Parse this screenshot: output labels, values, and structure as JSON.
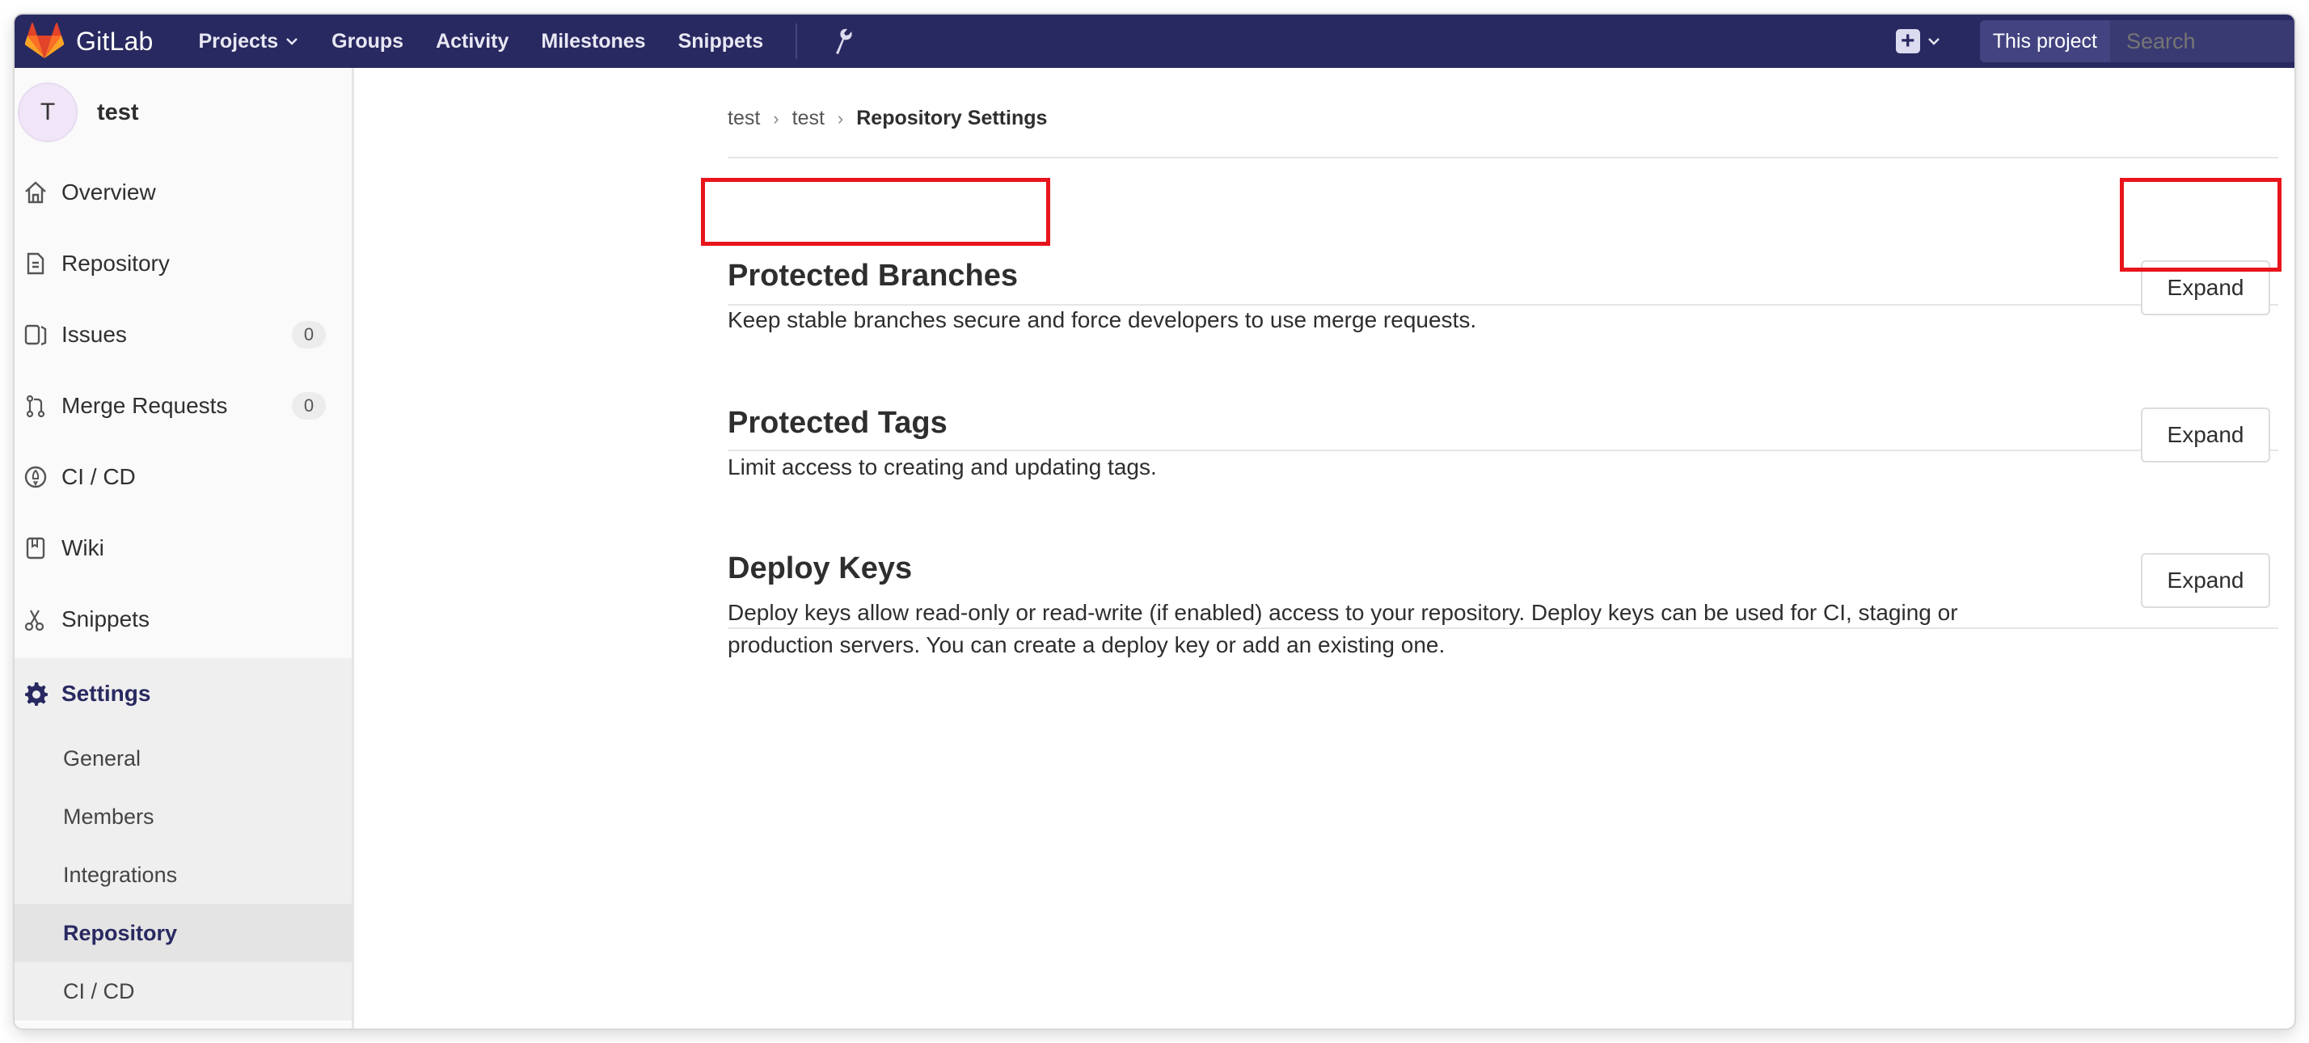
{
  "navbar": {
    "brand": "GitLab",
    "items": [
      {
        "label": "Projects",
        "has_dropdown": true
      },
      {
        "label": "Groups"
      },
      {
        "label": "Activity"
      },
      {
        "label": "Milestones"
      },
      {
        "label": "Snippets"
      }
    ],
    "scope_label": "This project",
    "search_placeholder": "Search",
    "colors": {
      "background": "#292961",
      "logo_orange": "#fc6d26"
    }
  },
  "sidebar": {
    "project_initial": "T",
    "project_name": "test",
    "items": [
      {
        "label": "Overview",
        "icon": "home-icon"
      },
      {
        "label": "Repository",
        "icon": "document-icon"
      },
      {
        "label": "Issues",
        "icon": "issues-icon",
        "count": "0"
      },
      {
        "label": "Merge Requests",
        "icon": "merge-request-icon",
        "count": "0"
      },
      {
        "label": "CI / CD",
        "icon": "rocket-icon"
      },
      {
        "label": "Wiki",
        "icon": "book-icon"
      },
      {
        "label": "Snippets",
        "icon": "scissors-icon"
      },
      {
        "label": "Settings",
        "icon": "gear-icon",
        "active": true
      }
    ],
    "settings_sub": [
      {
        "label": "General"
      },
      {
        "label": "Members"
      },
      {
        "label": "Integrations"
      },
      {
        "label": "Repository",
        "active": true
      },
      {
        "label": "CI / CD"
      }
    ]
  },
  "breadcrumb": {
    "items": [
      "test",
      "test"
    ],
    "current": "Repository Settings"
  },
  "sections": [
    {
      "title": "Protected Branches",
      "description": "Keep stable branches secure and force developers to use merge requests.",
      "button": "Expand"
    },
    {
      "title": "Protected Tags",
      "description": "Limit access to creating and updating tags.",
      "button": "Expand"
    },
    {
      "title": "Deploy Keys",
      "description_line1": "Deploy keys allow read-only or read-write (if enabled) access to your repository. Deploy keys can be used for CI, staging or",
      "description_line2": "production servers. You can create a deploy key or add an existing one.",
      "button": "Expand"
    }
  ]
}
